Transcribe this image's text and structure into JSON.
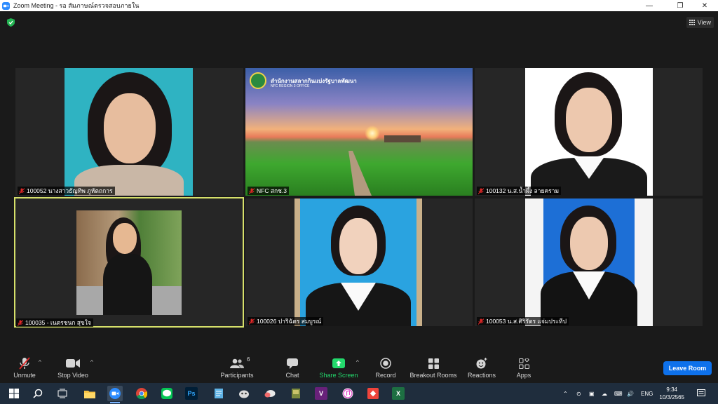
{
  "window": {
    "title": "Zoom Meeting - รอ สัมภาษณ์ตรวจสอบภายใน",
    "minimize": "—",
    "restore": "❐",
    "close": "✕"
  },
  "meeting": {
    "view_label": "View",
    "active_border_color": "#d6e06a",
    "tiles": [
      {
        "name": "100052 นางสาวธัญทิพ  ภูหัตถการ",
        "muted": true
      },
      {
        "name": "NFC สกช.3",
        "muted": true,
        "banner_text": "สำนักงานสลากกินแบ่งรัฐบาลพัฒนา",
        "banner_sub": "NFC REGION 3 OFFICE"
      },
      {
        "name": "100132 น.ส.น้ำผึ้ง ลายคราม",
        "muted": true
      },
      {
        "name": "100035 - เนตรชนก สุขใจ",
        "muted": true,
        "active": true
      },
      {
        "name": "100026 ปาริฉัตร สมบูรณ์",
        "muted": true
      },
      {
        "name": "100053 น.ส.ศิริรัตร แจ่มประทีป",
        "muted": true
      }
    ]
  },
  "toolbar": {
    "unmute": "Unmute",
    "stop_video": "Stop Video",
    "participants": "Participants",
    "participants_count": "6",
    "chat": "Chat",
    "share_screen": "Share Screen",
    "record": "Record",
    "breakout_rooms": "Breakout Rooms",
    "reactions": "Reactions",
    "apps": "Apps",
    "leave_room": "Leave Room",
    "share_color": "#23d96c",
    "leave_color": "#0e71eb"
  },
  "taskbar": {
    "apps": [
      "start-icon",
      "search-icon",
      "task-view-icon",
      "file-explorer-icon",
      "zoom-icon",
      "chrome-icon",
      "line-icon",
      "photoshop-icon",
      "notepad-icon",
      "app-icon",
      "cloud-icon",
      "game-icon",
      "visual-studio-icon",
      "itunes-icon",
      "anydesk-icon",
      "excel-icon"
    ],
    "ps_label": "Ps",
    "vs_label": "V",
    "excel_label": "X",
    "language": "ENG",
    "time": "9:34",
    "date": "10/3/2565"
  }
}
